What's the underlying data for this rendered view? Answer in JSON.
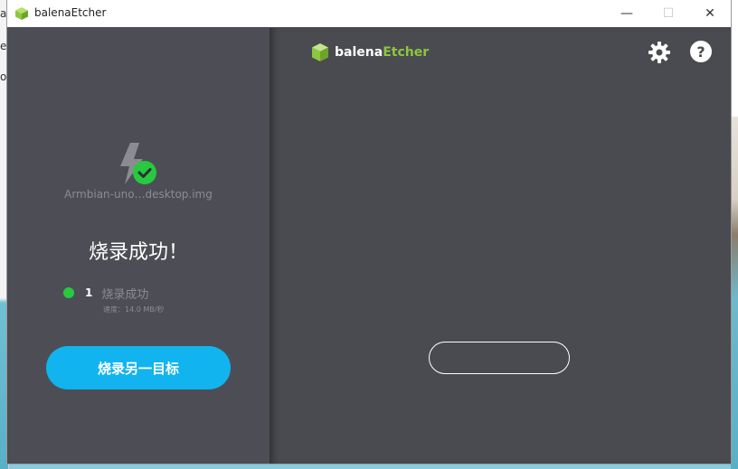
{
  "background": {
    "left_fragments": [
      "al",
      "e",
      "or"
    ]
  },
  "window": {
    "title": "balenaEtcher",
    "controls": {
      "minimize": "—",
      "maximize": "☐",
      "close": "✕"
    }
  },
  "left_panel": {
    "image_name": "Armbian-uno…desktop.img",
    "result_title": "烧录成功！",
    "status": {
      "count": "1",
      "label": "烧录成功",
      "speed": "速度：14.0 MB/秒"
    },
    "flash_again_label": "烧录另一目标"
  },
  "header": {
    "brand_prefix": "balena",
    "brand_suffix": "Etcher",
    "help_label": "?"
  },
  "icons": {
    "app": "etcher-cube-icon",
    "flash": "lightning-icon",
    "success": "check-circle-icon",
    "settings": "gear-icon",
    "help": "help-icon"
  },
  "colors": {
    "accent_blue": "#11b4ef",
    "success_green": "#27c93f",
    "brand_green": "#8dc63f",
    "left_panel": "#4d4e55",
    "right_panel": "#4a4b50"
  }
}
